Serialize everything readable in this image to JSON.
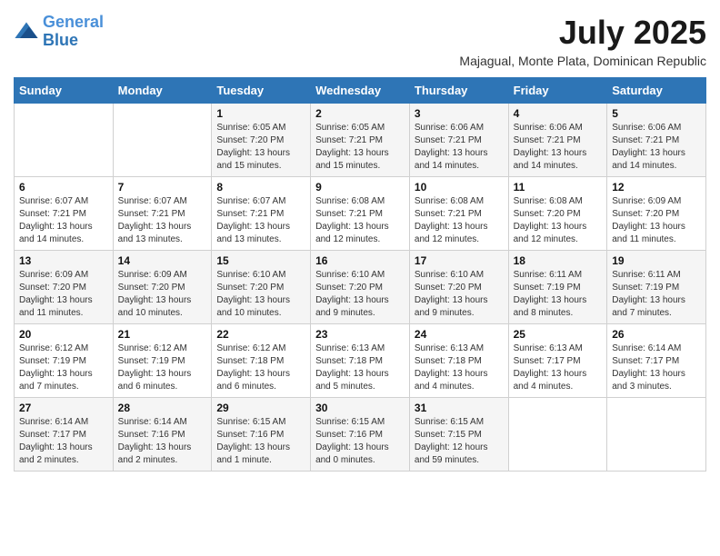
{
  "logo": {
    "line1": "General",
    "line2": "Blue"
  },
  "title": "July 2025",
  "subtitle": "Majagual, Monte Plata, Dominican Republic",
  "days_of_week": [
    "Sunday",
    "Monday",
    "Tuesday",
    "Wednesday",
    "Thursday",
    "Friday",
    "Saturday"
  ],
  "weeks": [
    [
      {
        "num": "",
        "info": ""
      },
      {
        "num": "",
        "info": ""
      },
      {
        "num": "1",
        "info": "Sunrise: 6:05 AM\nSunset: 7:20 PM\nDaylight: 13 hours\nand 15 minutes."
      },
      {
        "num": "2",
        "info": "Sunrise: 6:05 AM\nSunset: 7:21 PM\nDaylight: 13 hours\nand 15 minutes."
      },
      {
        "num": "3",
        "info": "Sunrise: 6:06 AM\nSunset: 7:21 PM\nDaylight: 13 hours\nand 14 minutes."
      },
      {
        "num": "4",
        "info": "Sunrise: 6:06 AM\nSunset: 7:21 PM\nDaylight: 13 hours\nand 14 minutes."
      },
      {
        "num": "5",
        "info": "Sunrise: 6:06 AM\nSunset: 7:21 PM\nDaylight: 13 hours\nand 14 minutes."
      }
    ],
    [
      {
        "num": "6",
        "info": "Sunrise: 6:07 AM\nSunset: 7:21 PM\nDaylight: 13 hours\nand 14 minutes."
      },
      {
        "num": "7",
        "info": "Sunrise: 6:07 AM\nSunset: 7:21 PM\nDaylight: 13 hours\nand 13 minutes."
      },
      {
        "num": "8",
        "info": "Sunrise: 6:07 AM\nSunset: 7:21 PM\nDaylight: 13 hours\nand 13 minutes."
      },
      {
        "num": "9",
        "info": "Sunrise: 6:08 AM\nSunset: 7:21 PM\nDaylight: 13 hours\nand 12 minutes."
      },
      {
        "num": "10",
        "info": "Sunrise: 6:08 AM\nSunset: 7:21 PM\nDaylight: 13 hours\nand 12 minutes."
      },
      {
        "num": "11",
        "info": "Sunrise: 6:08 AM\nSunset: 7:20 PM\nDaylight: 13 hours\nand 12 minutes."
      },
      {
        "num": "12",
        "info": "Sunrise: 6:09 AM\nSunset: 7:20 PM\nDaylight: 13 hours\nand 11 minutes."
      }
    ],
    [
      {
        "num": "13",
        "info": "Sunrise: 6:09 AM\nSunset: 7:20 PM\nDaylight: 13 hours\nand 11 minutes."
      },
      {
        "num": "14",
        "info": "Sunrise: 6:09 AM\nSunset: 7:20 PM\nDaylight: 13 hours\nand 10 minutes."
      },
      {
        "num": "15",
        "info": "Sunrise: 6:10 AM\nSunset: 7:20 PM\nDaylight: 13 hours\nand 10 minutes."
      },
      {
        "num": "16",
        "info": "Sunrise: 6:10 AM\nSunset: 7:20 PM\nDaylight: 13 hours\nand 9 minutes."
      },
      {
        "num": "17",
        "info": "Sunrise: 6:10 AM\nSunset: 7:20 PM\nDaylight: 13 hours\nand 9 minutes."
      },
      {
        "num": "18",
        "info": "Sunrise: 6:11 AM\nSunset: 7:19 PM\nDaylight: 13 hours\nand 8 minutes."
      },
      {
        "num": "19",
        "info": "Sunrise: 6:11 AM\nSunset: 7:19 PM\nDaylight: 13 hours\nand 7 minutes."
      }
    ],
    [
      {
        "num": "20",
        "info": "Sunrise: 6:12 AM\nSunset: 7:19 PM\nDaylight: 13 hours\nand 7 minutes."
      },
      {
        "num": "21",
        "info": "Sunrise: 6:12 AM\nSunset: 7:19 PM\nDaylight: 13 hours\nand 6 minutes."
      },
      {
        "num": "22",
        "info": "Sunrise: 6:12 AM\nSunset: 7:18 PM\nDaylight: 13 hours\nand 6 minutes."
      },
      {
        "num": "23",
        "info": "Sunrise: 6:13 AM\nSunset: 7:18 PM\nDaylight: 13 hours\nand 5 minutes."
      },
      {
        "num": "24",
        "info": "Sunrise: 6:13 AM\nSunset: 7:18 PM\nDaylight: 13 hours\nand 4 minutes."
      },
      {
        "num": "25",
        "info": "Sunrise: 6:13 AM\nSunset: 7:17 PM\nDaylight: 13 hours\nand 4 minutes."
      },
      {
        "num": "26",
        "info": "Sunrise: 6:14 AM\nSunset: 7:17 PM\nDaylight: 13 hours\nand 3 minutes."
      }
    ],
    [
      {
        "num": "27",
        "info": "Sunrise: 6:14 AM\nSunset: 7:17 PM\nDaylight: 13 hours\nand 2 minutes."
      },
      {
        "num": "28",
        "info": "Sunrise: 6:14 AM\nSunset: 7:16 PM\nDaylight: 13 hours\nand 2 minutes."
      },
      {
        "num": "29",
        "info": "Sunrise: 6:15 AM\nSunset: 7:16 PM\nDaylight: 13 hours\nand 1 minute."
      },
      {
        "num": "30",
        "info": "Sunrise: 6:15 AM\nSunset: 7:16 PM\nDaylight: 13 hours\nand 0 minutes."
      },
      {
        "num": "31",
        "info": "Sunrise: 6:15 AM\nSunset: 7:15 PM\nDaylight: 12 hours\nand 59 minutes."
      },
      {
        "num": "",
        "info": ""
      },
      {
        "num": "",
        "info": ""
      }
    ]
  ]
}
